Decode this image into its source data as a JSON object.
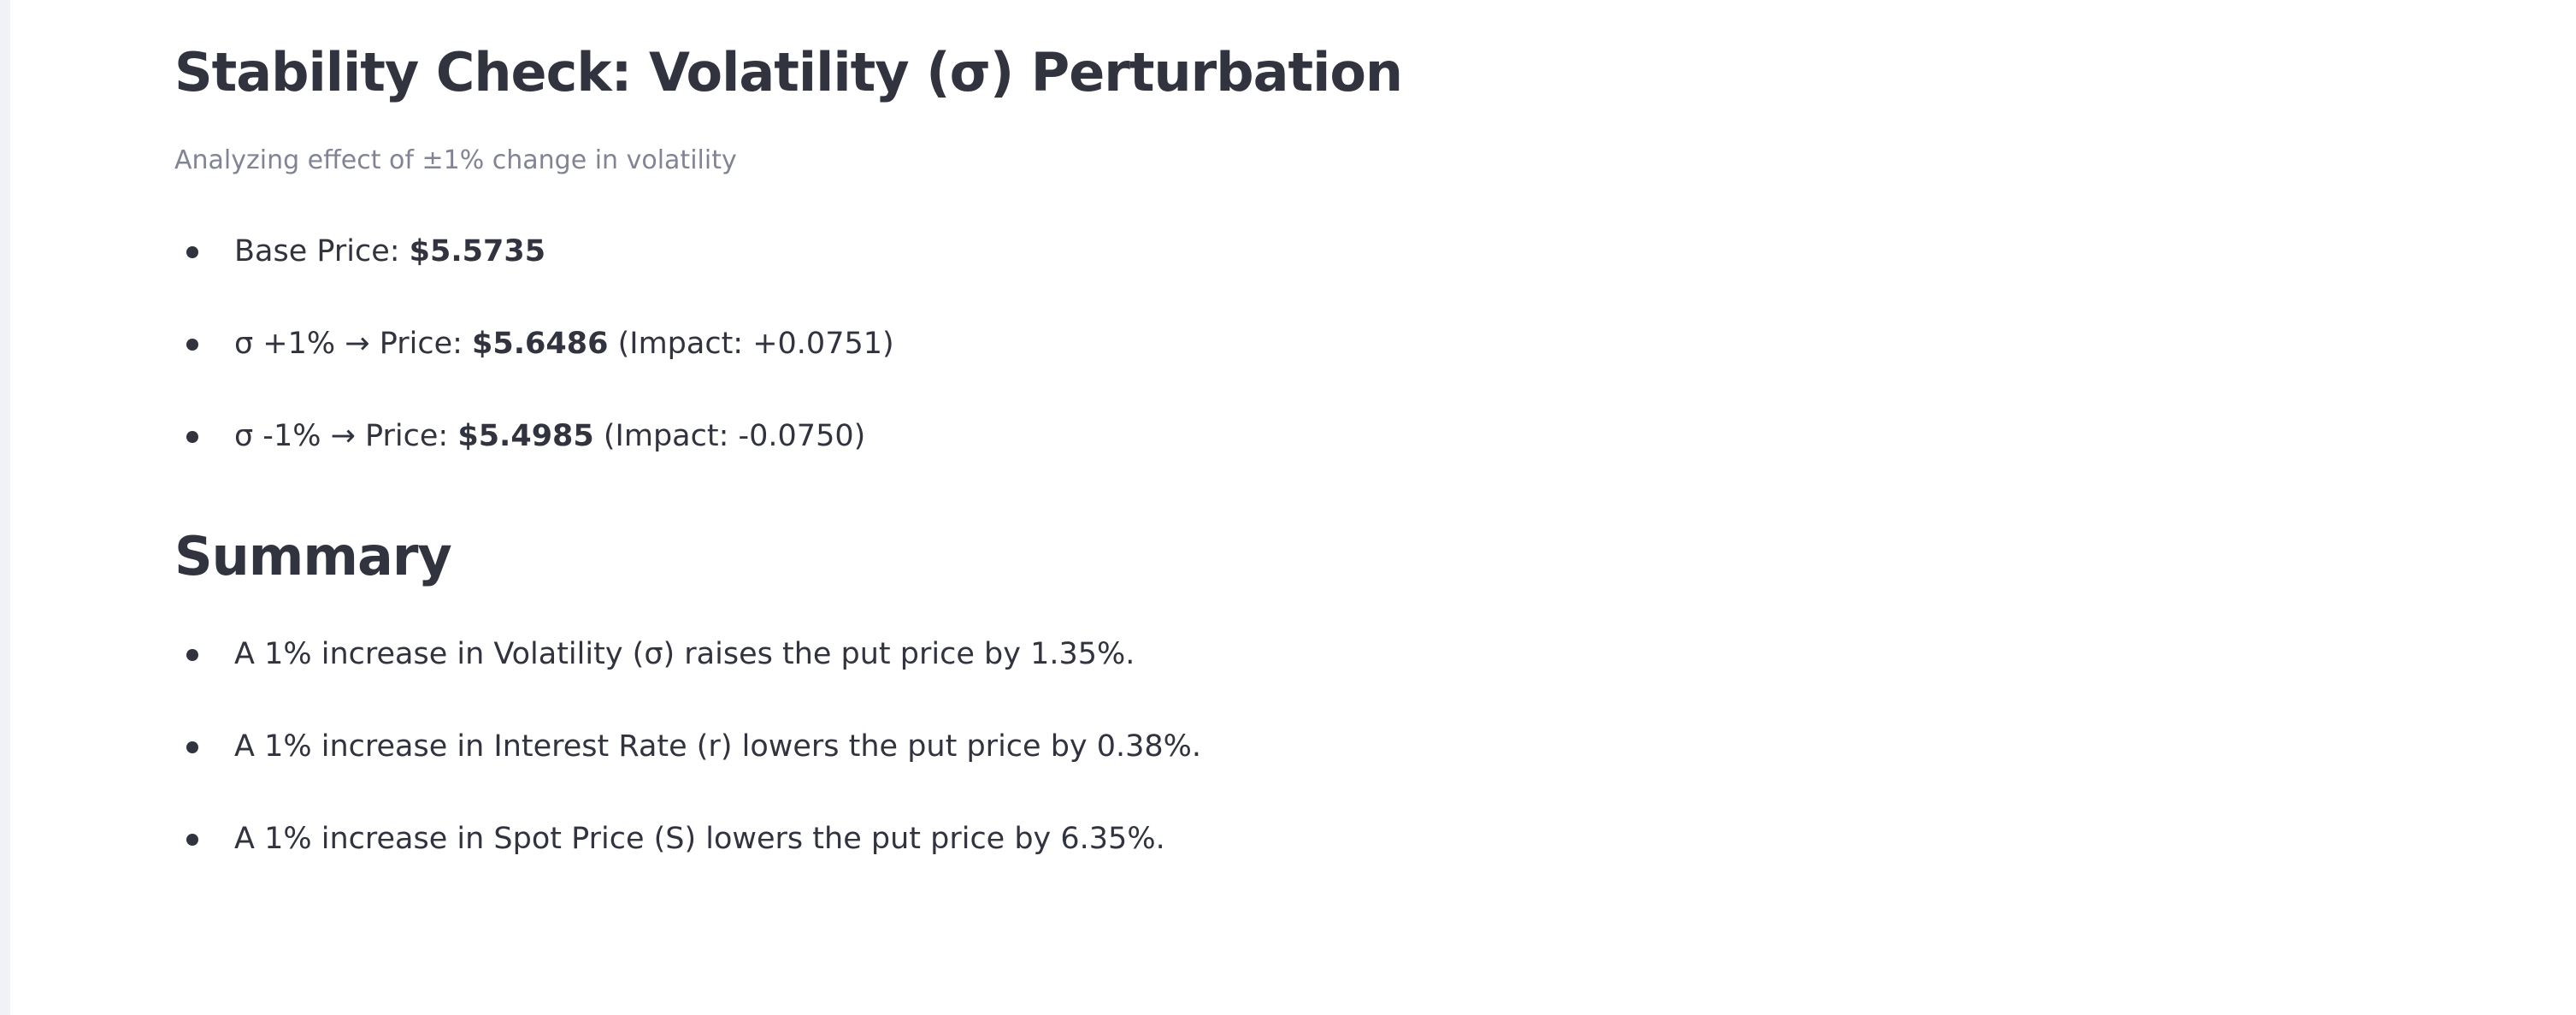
{
  "stability": {
    "title": "Stability Check: Volatility (σ) Perturbation",
    "caption": "Analyzing effect of ±1% change in volatility",
    "items": [
      {
        "prefix": "Base Price: ",
        "price": "$5.5735",
        "impact": ""
      },
      {
        "prefix": "σ +1% → Price: ",
        "price": "$5.6486",
        "impact": " (Impact: +0.0751)"
      },
      {
        "prefix": "σ -1% → Price: ",
        "price": "$5.4985",
        "impact": " (Impact: -0.0750)"
      }
    ]
  },
  "summary": {
    "title": "Summary",
    "items": [
      "A 1% increase in Volatility (σ) raises the put price by 1.35%.",
      "A 1% increase in Interest Rate (r) lowers the put price by 0.38%.",
      "A 1% increase in Spot Price (S) lowers the put price by 6.35%."
    ]
  },
  "colors": {
    "text": "#31333f",
    "caption": "#808495",
    "sidebar_strip": "#f0f2f6",
    "background": "#ffffff"
  }
}
